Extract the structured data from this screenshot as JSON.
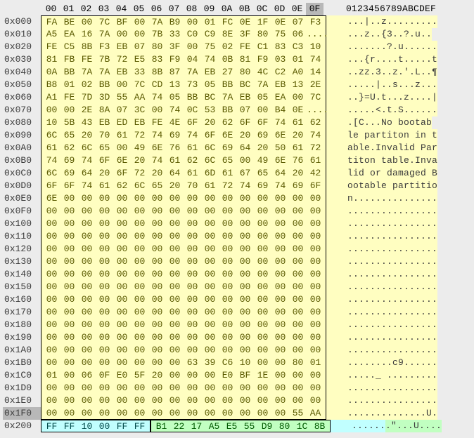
{
  "header": {
    "columns": [
      "00",
      "01",
      "02",
      "03",
      "04",
      "05",
      "06",
      "07",
      "08",
      "09",
      "0A",
      "0B",
      "0C",
      "0D",
      "0E",
      "0F"
    ],
    "ascii_header": "0123456789ABCDEF",
    "selected_col": 15
  },
  "selected_row": "0x1F0",
  "rows": [
    {
      "offset": "0x000",
      "hex": [
        "FA",
        "BE",
        "00",
        "7C",
        "BF",
        "00",
        "7A",
        "B9",
        "00",
        "01",
        "FC",
        "0E",
        "1F",
        "0E",
        "07",
        "F3"
      ],
      "ascii": "...|..z.........",
      "region": "main"
    },
    {
      "offset": "0x010",
      "hex": [
        "A5",
        "EA",
        "16",
        "7A",
        "00",
        "00",
        "7B",
        "33",
        "C0",
        "C9",
        "8E",
        "3F",
        "80",
        "75",
        "06",
        "........",
        "",
        "",
        "",
        "",
        "",
        "",
        "",
        "",
        ""
      ],
      "ascii": "...z..{3..?.u..",
      "region": "main"
    },
    {
      "offset": "0x020",
      "hex": [
        "FE",
        "C5",
        "8B",
        "F3",
        "EB",
        "07",
        "80",
        "3F",
        "00",
        "75",
        "02",
        "FE",
        "C1",
        "83",
        "C3",
        "10"
      ],
      "ascii": ".......?.u......",
      "region": "main"
    },
    {
      "offset": "0x030",
      "hex": [
        "81",
        "FB",
        "FE",
        "7B",
        "72",
        "E5",
        "83",
        "F9",
        "04",
        "74",
        "0B",
        "81",
        "F9",
        "03",
        "01",
        "74"
      ],
      "ascii": "...{r....t.....t",
      "region": "main"
    },
    {
      "offset": "0x040",
      "hex": [
        "0A",
        "BB",
        "7A",
        "7A",
        "EB",
        "33",
        "8B",
        "87",
        "7A",
        "EB",
        "27",
        "80",
        "4C",
        "C2",
        "A0",
        "14"
      ],
      "ascii": "..zz.3..z.'.L..¶",
      "region": "main"
    },
    {
      "offset": "0x050",
      "hex": [
        "B8",
        "01",
        "02",
        "BB",
        "00",
        "7C",
        "CD",
        "13",
        "73",
        "05",
        "BB",
        "BC",
        "7A",
        "EB",
        "13",
        "2E"
      ],
      "ascii": ".....|..s...z...",
      "region": "main"
    },
    {
      "offset": "0x060",
      "hex": [
        "A1",
        "FE",
        "7D",
        "3D",
        "55",
        "AA",
        "74",
        "05",
        "BB",
        "BC",
        "7A",
        "EB",
        "05",
        "EA",
        "00",
        "7C"
      ],
      "ascii": "..}=U.t...z....|",
      "region": "main"
    },
    {
      "offset": "0x070",
      "hex": [
        "00",
        "00",
        "2E",
        "8A",
        "07",
        "3C",
        "00",
        "74",
        "0C",
        "53",
        "BB",
        "07",
        "00",
        "B4",
        "0E",
        "....",
        "",
        "",
        "",
        ""
      ],
      "ascii": ".....<.t.S......",
      "region": "main"
    },
    {
      "offset": "0x080",
      "hex": [
        "10",
        "5B",
        "43",
        "EB",
        "ED",
        "EB",
        "FE",
        "4E",
        "6F",
        "20",
        "62",
        "6F",
        "6F",
        "74",
        "61",
        "62"
      ],
      "ascii": ".[C...No bootab",
      "region": "main"
    },
    {
      "offset": "0x090",
      "hex": [
        "6C",
        "65",
        "20",
        "70",
        "61",
        "72",
        "74",
        "69",
        "74",
        "6F",
        "6E",
        "20",
        "69",
        "6E",
        "20",
        "74"
      ],
      "ascii": "le partiton in t",
      "region": "main"
    },
    {
      "offset": "0x0A0",
      "hex": [
        "61",
        "62",
        "6C",
        "65",
        "00",
        "49",
        "6E",
        "76",
        "61",
        "6C",
        "69",
        "64",
        "20",
        "50",
        "61",
        "72"
      ],
      "ascii": "able.Invalid Par",
      "region": "main"
    },
    {
      "offset": "0x0B0",
      "hex": [
        "74",
        "69",
        "74",
        "6F",
        "6E",
        "20",
        "74",
        "61",
        "62",
        "6C",
        "65",
        "00",
        "49",
        "6E",
        "76",
        "61"
      ],
      "ascii": "titon table.Inva",
      "region": "main"
    },
    {
      "offset": "0x0C0",
      "hex": [
        "6C",
        "69",
        "64",
        "20",
        "6F",
        "72",
        "20",
        "64",
        "61",
        "6D",
        "61",
        "67",
        "65",
        "64",
        "20",
        "42"
      ],
      "ascii": "lid or damaged B",
      "region": "main"
    },
    {
      "offset": "0x0D0",
      "hex": [
        "6F",
        "6F",
        "74",
        "61",
        "62",
        "6C",
        "65",
        "20",
        "70",
        "61",
        "72",
        "74",
        "69",
        "74",
        "69",
        "6F"
      ],
      "ascii": "ootable partitio",
      "region": "main"
    },
    {
      "offset": "0x0E0",
      "hex": [
        "6E",
        "00",
        "00",
        "00",
        "00",
        "00",
        "00",
        "00",
        "00",
        "00",
        "00",
        "00",
        "00",
        "00",
        "00",
        "00"
      ],
      "ascii": "n...............",
      "region": "main"
    },
    {
      "offset": "0x0F0",
      "hex": [
        "00",
        "00",
        "00",
        "00",
        "00",
        "00",
        "00",
        "00",
        "00",
        "00",
        "00",
        "00",
        "00",
        "00",
        "00",
        "00"
      ],
      "ascii": "................",
      "region": "main"
    },
    {
      "offset": "0x100",
      "hex": [
        "00",
        "00",
        "00",
        "00",
        "00",
        "00",
        "00",
        "00",
        "00",
        "00",
        "00",
        "00",
        "00",
        "00",
        "00",
        "00"
      ],
      "ascii": "................",
      "region": "main"
    },
    {
      "offset": "0x110",
      "hex": [
        "00",
        "00",
        "00",
        "00",
        "00",
        "00",
        "00",
        "00",
        "00",
        "00",
        "00",
        "00",
        "00",
        "00",
        "00",
        "00"
      ],
      "ascii": "................",
      "region": "main"
    },
    {
      "offset": "0x120",
      "hex": [
        "00",
        "00",
        "00",
        "00",
        "00",
        "00",
        "00",
        "00",
        "00",
        "00",
        "00",
        "00",
        "00",
        "00",
        "00",
        "00"
      ],
      "ascii": "................",
      "region": "main"
    },
    {
      "offset": "0x130",
      "hex": [
        "00",
        "00",
        "00",
        "00",
        "00",
        "00",
        "00",
        "00",
        "00",
        "00",
        "00",
        "00",
        "00",
        "00",
        "00",
        "00"
      ],
      "ascii": "................",
      "region": "main"
    },
    {
      "offset": "0x140",
      "hex": [
        "00",
        "00",
        "00",
        "00",
        "00",
        "00",
        "00",
        "00",
        "00",
        "00",
        "00",
        "00",
        "00",
        "00",
        "00",
        "00"
      ],
      "ascii": "................",
      "region": "main"
    },
    {
      "offset": "0x150",
      "hex": [
        "00",
        "00",
        "00",
        "00",
        "00",
        "00",
        "00",
        "00",
        "00",
        "00",
        "00",
        "00",
        "00",
        "00",
        "00",
        "00"
      ],
      "ascii": "................",
      "region": "main"
    },
    {
      "offset": "0x160",
      "hex": [
        "00",
        "00",
        "00",
        "00",
        "00",
        "00",
        "00",
        "00",
        "00",
        "00",
        "00",
        "00",
        "00",
        "00",
        "00",
        "00"
      ],
      "ascii": "................",
      "region": "main"
    },
    {
      "offset": "0x170",
      "hex": [
        "00",
        "00",
        "00",
        "00",
        "00",
        "00",
        "00",
        "00",
        "00",
        "00",
        "00",
        "00",
        "00",
        "00",
        "00",
        "00"
      ],
      "ascii": "................",
      "region": "main"
    },
    {
      "offset": "0x180",
      "hex": [
        "00",
        "00",
        "00",
        "00",
        "00",
        "00",
        "00",
        "00",
        "00",
        "00",
        "00",
        "00",
        "00",
        "00",
        "00",
        "00"
      ],
      "ascii": "................",
      "region": "main"
    },
    {
      "offset": "0x190",
      "hex": [
        "00",
        "00",
        "00",
        "00",
        "00",
        "00",
        "00",
        "00",
        "00",
        "00",
        "00",
        "00",
        "00",
        "00",
        "00",
        "00"
      ],
      "ascii": "................",
      "region": "main"
    },
    {
      "offset": "0x1A0",
      "hex": [
        "00",
        "00",
        "00",
        "00",
        "00",
        "00",
        "00",
        "00",
        "00",
        "00",
        "00",
        "00",
        "00",
        "00",
        "00",
        "00"
      ],
      "ascii": "................",
      "region": "main"
    },
    {
      "offset": "0x1B0",
      "hex": [
        "00",
        "00",
        "00",
        "00",
        "00",
        "00",
        "00",
        "00",
        "63",
        "39",
        "C6",
        "10",
        "00",
        "00",
        "80",
        "01"
      ],
      "ascii": "........c9......",
      "region": "main"
    },
    {
      "offset": "0x1C0",
      "hex": [
        "01",
        "00",
        "06",
        "0F",
        "E0",
        "5F",
        "20",
        "00",
        "00",
        "00",
        "E0",
        "BF",
        "1E",
        "00",
        "00",
        "00"
      ],
      "ascii": "....._ .........",
      "region": "main"
    },
    {
      "offset": "0x1D0",
      "hex": [
        "00",
        "00",
        "00",
        "00",
        "00",
        "00",
        "00",
        "00",
        "00",
        "00",
        "00",
        "00",
        "00",
        "00",
        "00",
        "00"
      ],
      "ascii": "................",
      "region": "main"
    },
    {
      "offset": "0x1E0",
      "hex": [
        "00",
        "00",
        "00",
        "00",
        "00",
        "00",
        "00",
        "00",
        "00",
        "00",
        "00",
        "00",
        "00",
        "00",
        "00",
        "00"
      ],
      "ascii": "................",
      "region": "main"
    },
    {
      "offset": "0x1F0",
      "hex": [
        "00",
        "00",
        "00",
        "00",
        "00",
        "00",
        "00",
        "00",
        "00",
        "00",
        "00",
        "00",
        "00",
        "00",
        "55",
        "AA"
      ],
      "ascii": "..............U.",
      "region": "main"
    },
    {
      "offset": "0x200",
      "hex": [
        "FF",
        "FF",
        "10",
        "00",
        "FF",
        "FF",
        "B1",
        "22",
        "17",
        "A5",
        "E5",
        "55",
        "D9",
        "80",
        "1C",
        "8B"
      ],
      "ascii": ".......\"...U....",
      "region": "split",
      "split_at": 6,
      "r1": "r1",
      "r2": "r2"
    }
  ]
}
